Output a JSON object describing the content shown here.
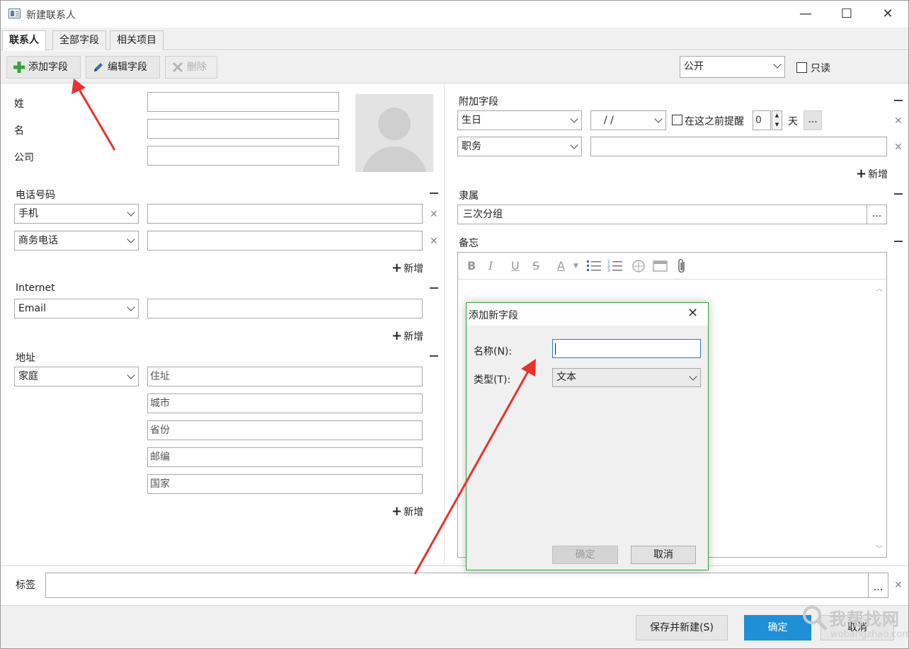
{
  "window": {
    "title": "新建联系人",
    "minimize": "—",
    "maximize": "☐",
    "close": "✕"
  },
  "tabs": [
    {
      "label": "联系人",
      "active": true
    },
    {
      "label": "全部字段",
      "active": false
    },
    {
      "label": "相关项目",
      "active": false
    }
  ],
  "toolbar": {
    "add_field": "添加字段",
    "edit_field": "编辑字段",
    "delete": "删除",
    "visibility_value": "公开",
    "readonly_label": "只读"
  },
  "name": {
    "last_name_label": "姓",
    "first_name_label": "名",
    "company_label": "公司"
  },
  "phone": {
    "section": "电话号码",
    "rows": [
      {
        "type": "手机",
        "value": ""
      },
      {
        "type": "商务电话",
        "value": ""
      }
    ],
    "add": "新增"
  },
  "internet": {
    "section": "Internet",
    "rows": [
      {
        "type": "Email",
        "value": ""
      }
    ],
    "add": "新增"
  },
  "address": {
    "section": "地址",
    "type": "家庭",
    "placeholders": {
      "street": "住址",
      "city": "城市",
      "province": "省份",
      "zip": "邮编",
      "country": "国家"
    },
    "add": "新增"
  },
  "extra": {
    "section": "附加字段",
    "birthday_label": "生日",
    "date_value": "/ /",
    "remind_label": "在这之前提醒",
    "remind_days": "0",
    "days_unit": "天",
    "more": "...",
    "title_label": "职务",
    "add": "新增"
  },
  "group": {
    "section": "隶属",
    "value": "三次分组",
    "more": "..."
  },
  "memo": {
    "section": "备忘",
    "tools": [
      "B",
      "I",
      "U",
      "S",
      "A"
    ]
  },
  "tags": {
    "label": "标签",
    "more": "..."
  },
  "footer": {
    "save_new": "保存并新建(S)",
    "ok": "确定",
    "cancel": "取消"
  },
  "dialog": {
    "title": "添加新字段",
    "name_label": "名称(N):",
    "name_value": "",
    "type_label": "类型(T):",
    "type_value": "文本",
    "ok": "确定",
    "cancel": "取消"
  },
  "watermark": {
    "text": "我帮找网",
    "url": "wobangzhao.com"
  },
  "colors": {
    "accent": "#1f8fd8",
    "arrow": "#e8322f",
    "dialog_border": "#3aa23a",
    "add_icon": "#3aa23a"
  }
}
